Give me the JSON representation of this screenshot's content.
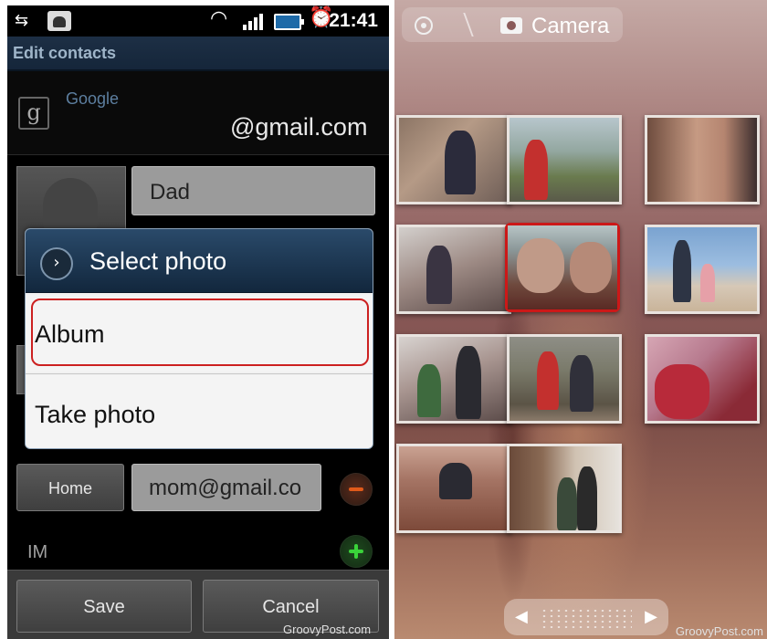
{
  "left_screen": {
    "status_bar": {
      "time": "21:41",
      "icons": [
        "usb-icon",
        "android-debug-icon",
        "wifi-icon",
        "signal-icon",
        "battery-icon",
        "alarm-icon"
      ]
    },
    "title": "Edit contacts",
    "account": {
      "type_label": "Google",
      "email": "@gmail.com",
      "icon": "g-icon"
    },
    "name_field_value": "Dad",
    "email_row": {
      "type_button_label": "Home",
      "value": "mom@gmail.co"
    },
    "im_label": "IM",
    "footer": {
      "save_label": "Save",
      "cancel_label": "Cancel"
    },
    "dialog": {
      "title": "Select photo",
      "options": [
        {
          "label": "Album",
          "highlighted": true
        },
        {
          "label": "Take photo",
          "highlighted": false
        }
      ]
    },
    "watermark": "GroovyPost.com"
  },
  "right_screen": {
    "breadcrumb": {
      "home_icon": "target-icon",
      "album_icon": "camera-icon",
      "album_label": "Camera"
    },
    "thumbnails_count": 11,
    "selected_thumbnail_index": 4,
    "watermark": "GroovyPost.com"
  },
  "colors": {
    "highlight_red": "#cc1818",
    "title_bar_blue": "#15263a",
    "dialog_header_blue": "#1e3a58"
  }
}
